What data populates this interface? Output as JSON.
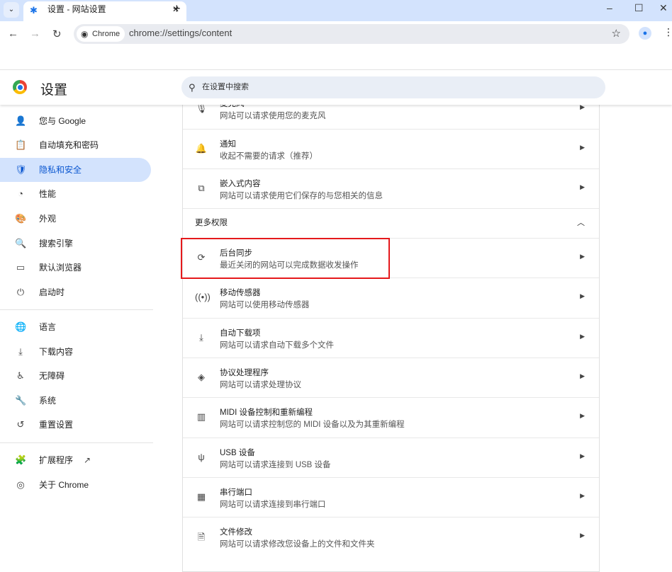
{
  "browser": {
    "tab_title": "设置 - 网站设置",
    "new_tab": "+",
    "chip": "Chrome",
    "url": "chrome://settings/content"
  },
  "header": {
    "title": "设置",
    "search_placeholder": "在设置中搜索"
  },
  "sidebar": {
    "items": [
      {
        "label": "您与 Google",
        "icon": "person-icon",
        "glyph": "👤"
      },
      {
        "label": "自动填充和密码",
        "icon": "clipboard-icon",
        "glyph": "📋"
      },
      {
        "label": "隐私和安全",
        "icon": "shield-icon",
        "glyph": "🛡",
        "selected": true
      },
      {
        "label": "性能",
        "icon": "speedometer-icon",
        "glyph": "◔"
      },
      {
        "label": "外观",
        "icon": "palette-icon",
        "glyph": "🎨"
      },
      {
        "label": "搜索引擎",
        "icon": "search-icon",
        "glyph": "🔍"
      },
      {
        "label": "默认浏览器",
        "icon": "browser-icon",
        "glyph": "▭"
      },
      {
        "label": "启动时",
        "icon": "power-icon",
        "glyph": "⏻"
      },
      {
        "label": "语言",
        "icon": "globe-icon",
        "glyph": "🌐"
      },
      {
        "label": "下载内容",
        "icon": "download-icon",
        "glyph": "⤓"
      },
      {
        "label": "无障碍",
        "icon": "accessibility-icon",
        "glyph": "♿"
      },
      {
        "label": "系统",
        "icon": "wrench-icon",
        "glyph": "🔧"
      },
      {
        "label": "重置设置",
        "icon": "reset-icon",
        "glyph": "↺"
      },
      {
        "label": "扩展程序",
        "icon": "puzzle-icon",
        "glyph": "🧩"
      },
      {
        "label": "关于 Chrome",
        "icon": "chrome-icon",
        "glyph": "◎"
      }
    ]
  },
  "content": {
    "top_rows": [
      {
        "title": "麦克风",
        "desc": "网站可以请求使用您的麦克风",
        "icon": "microphone-icon",
        "glyph": "🎙"
      },
      {
        "title": "通知",
        "desc": "收起不需要的请求（推荐）",
        "icon": "bell-icon",
        "glyph": "🔔"
      },
      {
        "title": "嵌入式内容",
        "desc": "网站可以请求使用它们保存的与您相关的信息",
        "icon": "embedded-content-icon",
        "glyph": "⧉"
      }
    ],
    "section_title": "更多权限",
    "more_rows": [
      {
        "title": "后台同步",
        "desc": "最近关闭的网站可以完成数据收发操作",
        "icon": "sync-icon",
        "glyph": "⟳",
        "highlighted": true
      },
      {
        "title": "移动传感器",
        "desc": "网站可以使用移动传感器",
        "icon": "motion-sensor-icon",
        "glyph": "((•))"
      },
      {
        "title": "自动下载项",
        "desc": "网站可以请求自动下载多个文件",
        "icon": "download-icon",
        "glyph": "⤓"
      },
      {
        "title": "协议处理程序",
        "desc": "网站可以请求处理协议",
        "icon": "protocol-handler-icon",
        "glyph": "◈"
      },
      {
        "title": "MIDI 设备控制和重新编程",
        "desc": "网站可以请求控制您的 MIDI 设备以及为其重新编程",
        "icon": "piano-icon",
        "glyph": "▥"
      },
      {
        "title": "USB 设备",
        "desc": "网站可以请求连接到 USB 设备",
        "icon": "usb-icon",
        "glyph": "ψ"
      },
      {
        "title": "串行端口",
        "desc": "网站可以请求连接到串行端口",
        "icon": "serial-port-icon",
        "glyph": "▦"
      },
      {
        "title": "文件修改",
        "desc": "网站可以请求修改您设备上的文件和文件夹",
        "icon": "file-edit-icon",
        "glyph": "🗎"
      }
    ]
  },
  "colors": {
    "accent": "#0b57d0",
    "selected_bg": "#d3e3fd",
    "highlight_box": "#e5191c"
  }
}
